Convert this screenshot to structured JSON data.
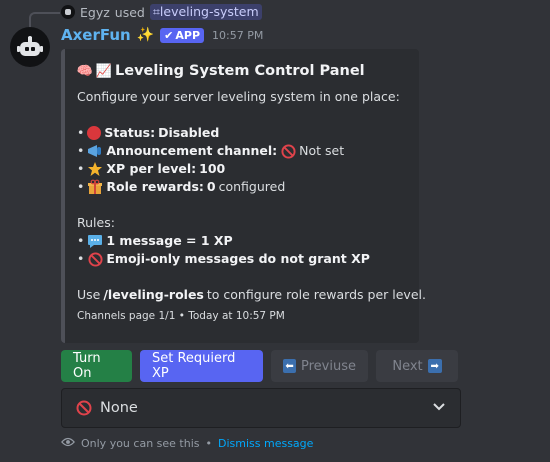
{
  "reply": {
    "user": "Egyz",
    "used_text": "used",
    "command": "leveling-system"
  },
  "message": {
    "username": "AxerFun",
    "sparkle": "✨",
    "app_badge": "APP",
    "badge_check": "✔",
    "timestamp": "10:57 PM"
  },
  "embed": {
    "title": "Leveling System Control Panel",
    "title_emojis": [
      "🧠",
      "📈"
    ],
    "intro": "Configure your server leveling system in one place:",
    "status": {
      "bullet": "•",
      "label": "Status:",
      "value": "Disabled",
      "color": "#da373c"
    },
    "announcement": {
      "label": "Announcement channel:",
      "value": "Not set"
    },
    "xp": {
      "label": "XP per level:",
      "value": "100"
    },
    "roles": {
      "label": "Role rewards:",
      "count": "0",
      "suffix": "configured"
    },
    "rules_heading": "Rules:",
    "rule1": "1 message = 1 XP",
    "rule2": "Emoji-only messages do not grant XP",
    "usage_prefix": "Use",
    "usage_cmd": "/leveling-roles",
    "usage_suffix": "to configure role rewards per level.",
    "footer": "Channels page 1/1 • Today at 10:57 PM"
  },
  "buttons": {
    "turn_on": "Turn On",
    "set_xp": "Set Requierd XP",
    "previous": "Previuse",
    "next": "Next"
  },
  "select": {
    "value": "None"
  },
  "ephemeral": {
    "notice": "Only you can see this",
    "sep": "•",
    "dismiss": "Dismiss message"
  },
  "colors": {
    "accent": "#5865f2",
    "success": "#248046",
    "link": "#00a8fc",
    "username": "#5fb3f0",
    "status_red": "#da373c"
  }
}
